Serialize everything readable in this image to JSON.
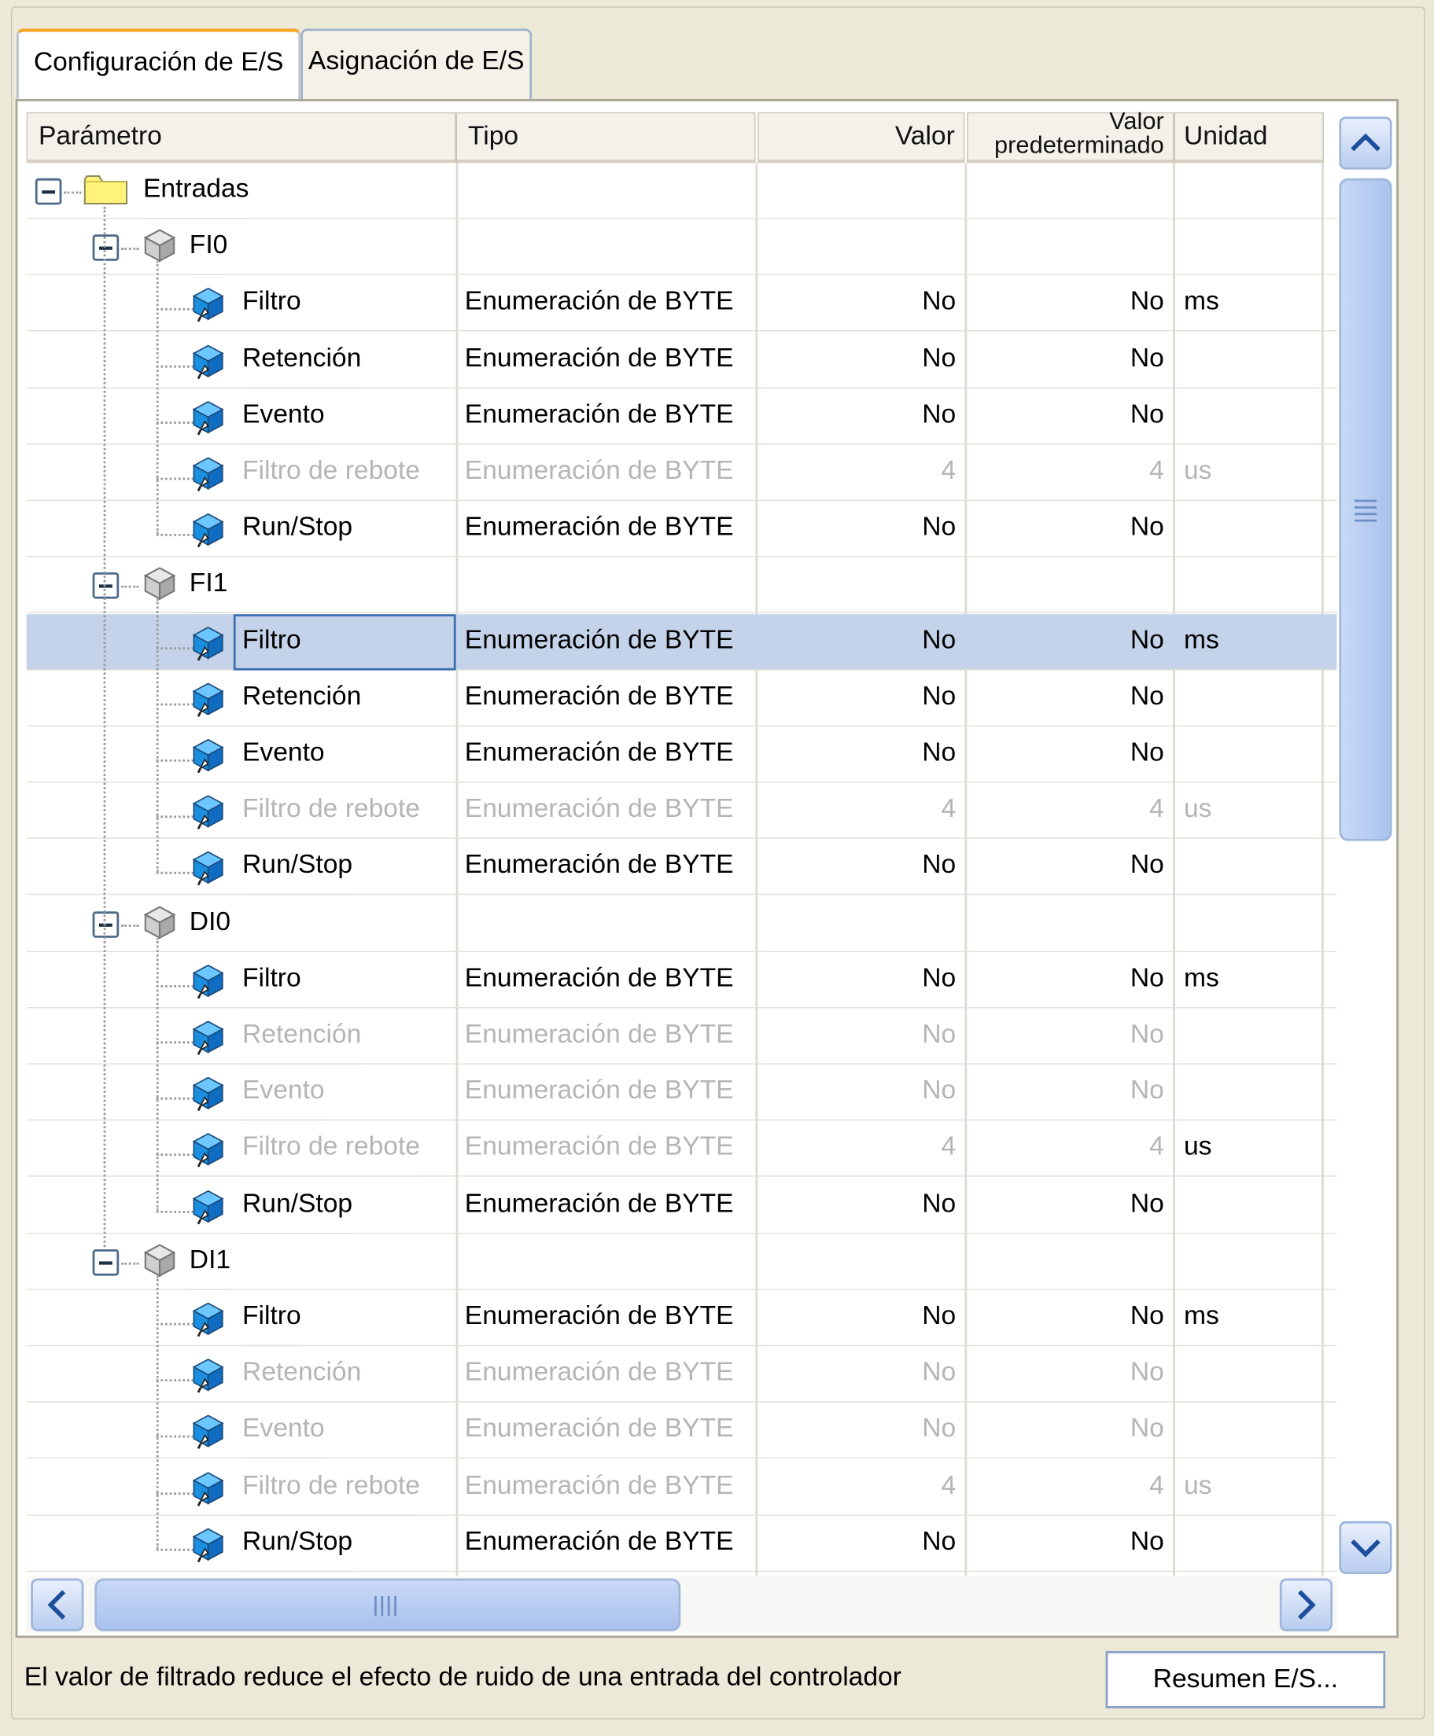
{
  "tabs": [
    {
      "label": "Configuración de E/S",
      "active": true
    },
    {
      "label": "Asignación de E/S",
      "active": false
    }
  ],
  "columns": {
    "parametro": "Parámetro",
    "tipo": "Tipo",
    "valor": "Valor",
    "valor_predeterminado_line1": "Valor",
    "valor_predeterminado_line2": "predeterminado",
    "unidad": "Unidad"
  },
  "tree": {
    "root_label": "Entradas",
    "groups": [
      {
        "label": "FI0",
        "params": [
          {
            "name": "Filtro",
            "tipo": "Enumeración de BYTE",
            "valor": "No",
            "default": "No",
            "unidad": "ms",
            "enabled": true
          },
          {
            "name": "Retención",
            "tipo": "Enumeración de BYTE",
            "valor": "No",
            "default": "No",
            "unidad": "",
            "enabled": true
          },
          {
            "name": "Evento",
            "tipo": "Enumeración de BYTE",
            "valor": "No",
            "default": "No",
            "unidad": "",
            "enabled": true
          },
          {
            "name": "Filtro de rebote",
            "tipo": "Enumeración de BYTE",
            "valor": "4",
            "default": "4",
            "unidad": "us",
            "enabled": false
          },
          {
            "name": "Run/Stop",
            "tipo": "Enumeración de BYTE",
            "valor": "No",
            "default": "No",
            "unidad": "",
            "enabled": true
          }
        ]
      },
      {
        "label": "FI1",
        "params": [
          {
            "name": "Filtro",
            "tipo": "Enumeración de BYTE",
            "valor": "No",
            "default": "No",
            "unidad": "ms",
            "enabled": true,
            "selected": true
          },
          {
            "name": "Retención",
            "tipo": "Enumeración de BYTE",
            "valor": "No",
            "default": "No",
            "unidad": "",
            "enabled": true
          },
          {
            "name": "Evento",
            "tipo": "Enumeración de BYTE",
            "valor": "No",
            "default": "No",
            "unidad": "",
            "enabled": true
          },
          {
            "name": "Filtro de rebote",
            "tipo": "Enumeración de BYTE",
            "valor": "4",
            "default": "4",
            "unidad": "us",
            "enabled": false
          },
          {
            "name": "Run/Stop",
            "tipo": "Enumeración de BYTE",
            "valor": "No",
            "default": "No",
            "unidad": "",
            "enabled": true
          }
        ]
      },
      {
        "label": "DI0",
        "params": [
          {
            "name": "Filtro",
            "tipo": "Enumeración de BYTE",
            "valor": "No",
            "default": "No",
            "unidad": "ms",
            "enabled": true
          },
          {
            "name": "Retención",
            "tipo": "Enumeración de BYTE",
            "valor": "No",
            "default": "No",
            "unidad": "",
            "enabled": false
          },
          {
            "name": "Evento",
            "tipo": "Enumeración de BYTE",
            "valor": "No",
            "default": "No",
            "unidad": "",
            "enabled": false
          },
          {
            "name": "Filtro de rebote",
            "tipo": "Enumeración de BYTE",
            "valor": "4",
            "default": "4",
            "unidad": "us",
            "enabled": false,
            "unit_enabled": true
          },
          {
            "name": "Run/Stop",
            "tipo": "Enumeración de BYTE",
            "valor": "No",
            "default": "No",
            "unidad": "",
            "enabled": true
          }
        ]
      },
      {
        "label": "DI1",
        "params": [
          {
            "name": "Filtro",
            "tipo": "Enumeración de BYTE",
            "valor": "No",
            "default": "No",
            "unidad": "ms",
            "enabled": true
          },
          {
            "name": "Retención",
            "tipo": "Enumeración de BYTE",
            "valor": "No",
            "default": "No",
            "unidad": "",
            "enabled": false
          },
          {
            "name": "Evento",
            "tipo": "Enumeración de BYTE",
            "valor": "No",
            "default": "No",
            "unidad": "",
            "enabled": false
          },
          {
            "name": "Filtro de rebote",
            "tipo": "Enumeración de BYTE",
            "valor": "4",
            "default": "4",
            "unidad": "us",
            "enabled": false
          },
          {
            "name": "Run/Stop",
            "tipo": "Enumeración de BYTE",
            "valor": "No",
            "default": "No",
            "unidad": "",
            "enabled": true
          }
        ]
      }
    ]
  },
  "status_text": "El valor de filtrado reduce el efecto de ruido de una entrada del controlador",
  "summary_button": "Resumen E/S...",
  "icons": {
    "expander": "collapse-minus-icon",
    "root": "folder-icon",
    "group": "cube-icon",
    "param": "parameter-icon",
    "scroll_up": "chevron-up-icon",
    "scroll_down": "chevron-down-icon",
    "scroll_left": "chevron-left-icon",
    "scroll_right": "chevron-right-icon"
  },
  "colors": {
    "selection": "#c4d3ea",
    "active_tab_accent": "#f5a623",
    "disabled_text": "#b5b5b5",
    "folder": "#fff27a",
    "param_icon": "#1a8fe0"
  }
}
